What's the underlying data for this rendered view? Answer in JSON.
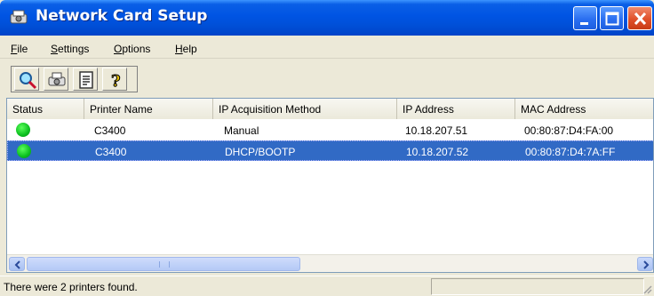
{
  "window": {
    "title": "Network Card Setup",
    "title_icon": "network-card-icon"
  },
  "menu": {
    "items": [
      {
        "label": "File",
        "accel": "F",
        "rest": "ile"
      },
      {
        "label": "Settings",
        "accel": "S",
        "rest": "ettings"
      },
      {
        "label": "Options",
        "accel": "O",
        "rest": "ptions"
      },
      {
        "label": "Help",
        "accel": "H",
        "rest": "elp"
      }
    ]
  },
  "toolbar": {
    "buttons": [
      "search-icon",
      "printer-icon",
      "properties-icon",
      "help-icon"
    ]
  },
  "list": {
    "columns": [
      "Status",
      "Printer Name",
      "IP Acquisition Method",
      "IP Address",
      "MAC Address"
    ],
    "rows": [
      {
        "status": "online",
        "name": "C3400",
        "method": "Manual",
        "ip": "10.18.207.51",
        "mac": "00:80:87:D4:FA:00",
        "selected": false
      },
      {
        "status": "online",
        "name": "C3400",
        "method": "DHCP/BOOTP",
        "ip": "10.18.207.52",
        "mac": "00:80:87:D4:7A:FF",
        "selected": true
      }
    ]
  },
  "status_bar": {
    "text": "There were 2 printers found."
  },
  "colors": {
    "titlebar": "#0054e3",
    "selection": "#316ac5",
    "status_online": "#0bbf1f"
  }
}
